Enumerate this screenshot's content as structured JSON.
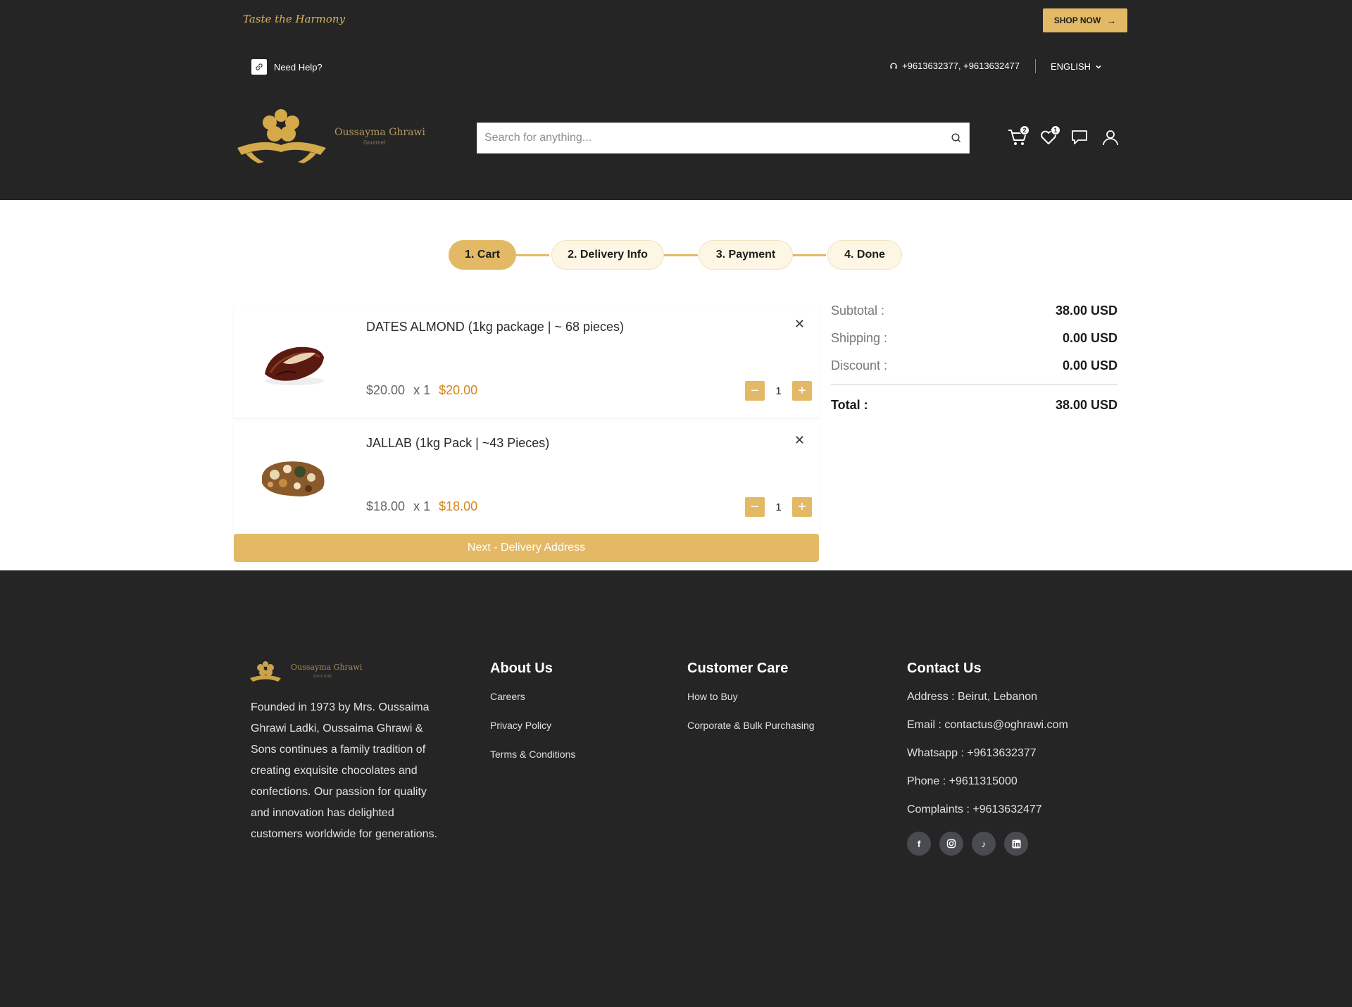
{
  "header": {
    "tagline": "Taste the Harmony",
    "shop_now": "SHOP NOW",
    "help": "Need Help?",
    "phones": "+9613632377, +9613632477",
    "language": "ENGLISH",
    "logo_name": "Oussayma Ghrawi",
    "logo_sub": "Gourmet",
    "search_placeholder": "Search for anything...",
    "cart_count": "2",
    "wishlist_count": "1"
  },
  "steps": [
    {
      "label": "1. Cart",
      "active": true
    },
    {
      "label": "2. Delivery Info",
      "active": false
    },
    {
      "label": "3. Payment",
      "active": false
    },
    {
      "label": "4. Done",
      "active": false
    }
  ],
  "cart": {
    "items": [
      {
        "title": "DATES ALMOND (1kg package | ~ 68 pieces)",
        "unit_price": "$20.00",
        "qty_text": "x 1",
        "total": "$20.00",
        "qty": "1"
      },
      {
        "title": "JALLAB (1kg Pack | ~43 Pieces)",
        "unit_price": "$18.00",
        "qty_text": "x 1",
        "total": "$18.00",
        "qty": "1"
      }
    ],
    "next_label": "Next - Delivery Address"
  },
  "summary": {
    "subtotal_label": "Subtotal :",
    "subtotal": "38.00 USD",
    "shipping_label": "Shipping :",
    "shipping": "0.00 USD",
    "discount_label": "Discount :",
    "discount": "0.00 USD",
    "total_label": "Total :",
    "total": "38.00 USD"
  },
  "footer": {
    "logo_name": "Oussayma Ghrawi",
    "about_text": "Founded in 1973 by Mrs. Oussaima Ghrawi Ladki, Oussaima Ghrawi & Sons continues a family tradition of creating exquisite chocolates and confections. Our passion for quality and innovation has delighted customers worldwide for generations.",
    "about_us": {
      "title": "About Us",
      "links": [
        "Careers",
        "Privacy Policy",
        "Terms & Conditions"
      ]
    },
    "customer_care": {
      "title": "Customer Care",
      "links": [
        "How to Buy",
        "Corporate & Bulk Purchasing"
      ]
    },
    "contact": {
      "title": "Contact Us",
      "lines": [
        "Address :  Beirut, Lebanon",
        "Email :  contactus@oghrawi.com",
        "Whatsapp :  +9613632377",
        "Phone :  +9611315000",
        "Complaints :  +9613632477"
      ]
    },
    "socials": [
      "facebook-icon",
      "instagram-icon",
      "tiktok-icon",
      "linkedin-icon"
    ]
  }
}
